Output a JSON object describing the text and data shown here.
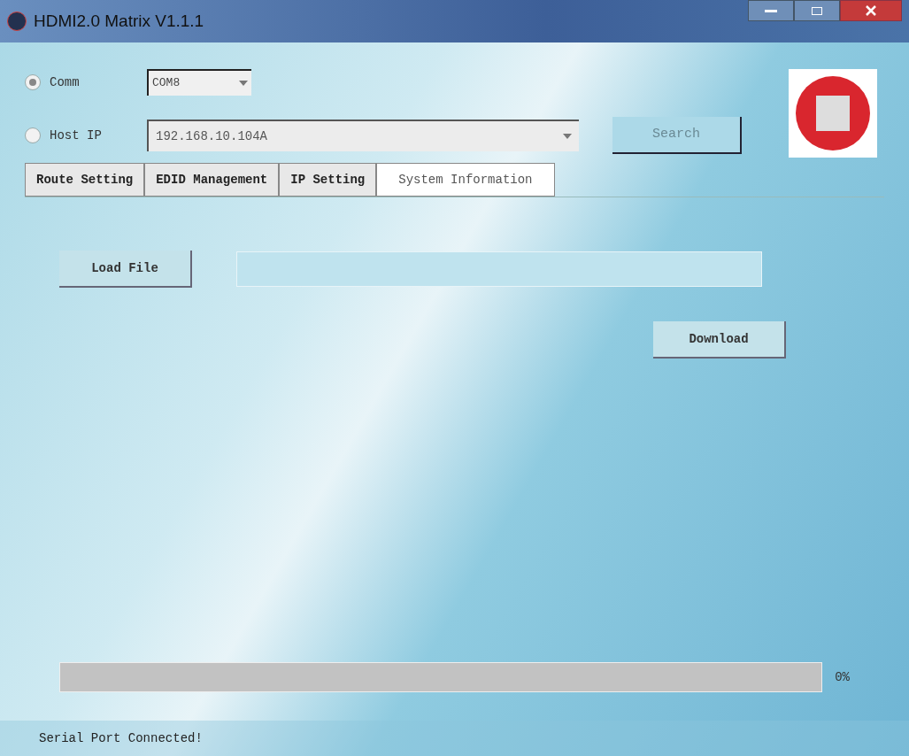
{
  "window": {
    "title": "HDMI2.0 Matrix V1.1.1"
  },
  "connection": [
    {
      "label": "Comm",
      "selected": true,
      "kind": "combo",
      "value": "COM8"
    },
    {
      "label": "Host IP",
      "selected": false,
      "kind": "ip",
      "value": "192.168.10.104A"
    }
  ],
  "search_button": "Search",
  "tabs": [
    {
      "label": "Route Setting",
      "selected": false
    },
    {
      "label": "EDID Management",
      "selected": false
    },
    {
      "label": "IP Setting",
      "selected": false
    },
    {
      "label": "System Information",
      "selected": true
    }
  ],
  "load_file_button": "Load File",
  "download_button": "Download",
  "progress": {
    "level": 0,
    "reading": "0%"
  },
  "status_bar": "Serial Port Connected!"
}
